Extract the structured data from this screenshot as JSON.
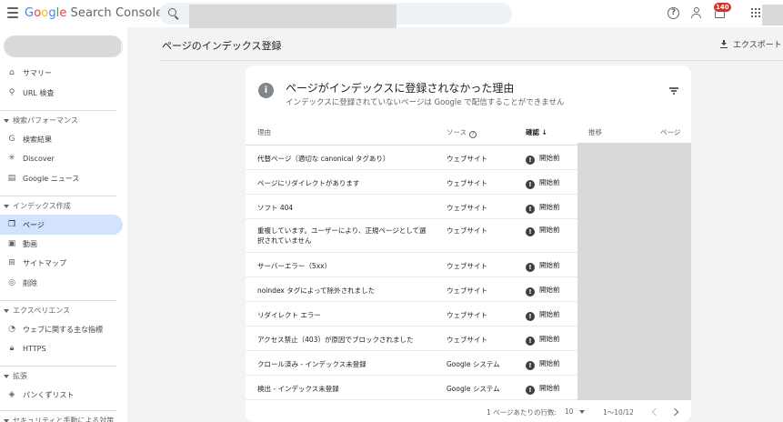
{
  "app": {
    "logo_google": "Google",
    "logo_product": "Search Console",
    "notification_count": "140",
    "help_glyph": "?"
  },
  "sidebar": {
    "items": [
      {
        "label": "サマリー",
        "icon": "home-icon"
      },
      {
        "label": "URL 検査",
        "icon": "search-icon"
      },
      {
        "label": "検索パフォーマンス",
        "section": true
      },
      {
        "label": "検索結果",
        "icon": "google-g-icon"
      },
      {
        "label": "Discover",
        "icon": "asterisk-icon"
      },
      {
        "label": "Google ニュース",
        "icon": "news-icon"
      },
      {
        "label": "インデックス作成",
        "section": true
      },
      {
        "label": "ページ",
        "icon": "pages-icon",
        "active": true
      },
      {
        "label": "動画",
        "icon": "video-icon"
      },
      {
        "label": "サイトマップ",
        "icon": "sitemap-icon"
      },
      {
        "label": "削除",
        "icon": "eye-off-icon"
      },
      {
        "label": "エクスペリエンス",
        "section": true
      },
      {
        "label": "ウェブに関する主な指標",
        "icon": "gauge-icon"
      },
      {
        "label": "HTTPS",
        "icon": "lock-icon"
      },
      {
        "label": "拡張",
        "section": true
      },
      {
        "label": "パンくずリスト",
        "icon": "layers-icon"
      },
      {
        "label": "セキュリティと手動による対策",
        "section": true
      }
    ]
  },
  "main": {
    "page_title": "ページのインデックス登録",
    "export_label": "エクスポート"
  },
  "card": {
    "info_glyph": "i",
    "title": "ページがインデックスに登録されなかった理由",
    "subtitle": "インデックスに登録されていないページは Google で配信することができません",
    "columns": {
      "reason": "理由",
      "source": "ソース",
      "validation": "確認",
      "trend": "推移",
      "pages": "ページ"
    },
    "rows": [
      {
        "reason": "代替ページ（適切な canonical タグあり）",
        "source": "ウェブサイト",
        "status": "開始前"
      },
      {
        "reason": "ページにリダイレクトがあります",
        "source": "ウェブサイト",
        "status": "開始前"
      },
      {
        "reason": "ソフト 404",
        "source": "ウェブサイト",
        "status": "開始前"
      },
      {
        "reason": "重複しています。ユーザーにより、正規ページとして選択されていません",
        "source": "ウェブサイト",
        "status": "開始前"
      },
      {
        "reason": "サーバーエラー（5xx）",
        "source": "ウェブサイト",
        "status": "開始前"
      },
      {
        "reason": "noindex タグによって除外されました",
        "source": "ウェブサイト",
        "status": "開始前"
      },
      {
        "reason": "リダイレクト エラー",
        "source": "ウェブサイト",
        "status": "開始前"
      },
      {
        "reason": "アクセス禁止（403）が原因でブロックされました",
        "source": "ウェブサイト",
        "status": "開始前"
      },
      {
        "reason": "クロール済み - インデックス未登録",
        "source": "Google システム",
        "status": "開始前"
      },
      {
        "reason": "検出 - インデックス未登録",
        "source": "Google システム",
        "status": "開始前"
      }
    ],
    "status_glyph": "!",
    "pagination": {
      "rows_per_page_label": "1 ページあたりの行数:",
      "rows_per_page_value": "10",
      "range": "1〜10/12"
    }
  }
}
